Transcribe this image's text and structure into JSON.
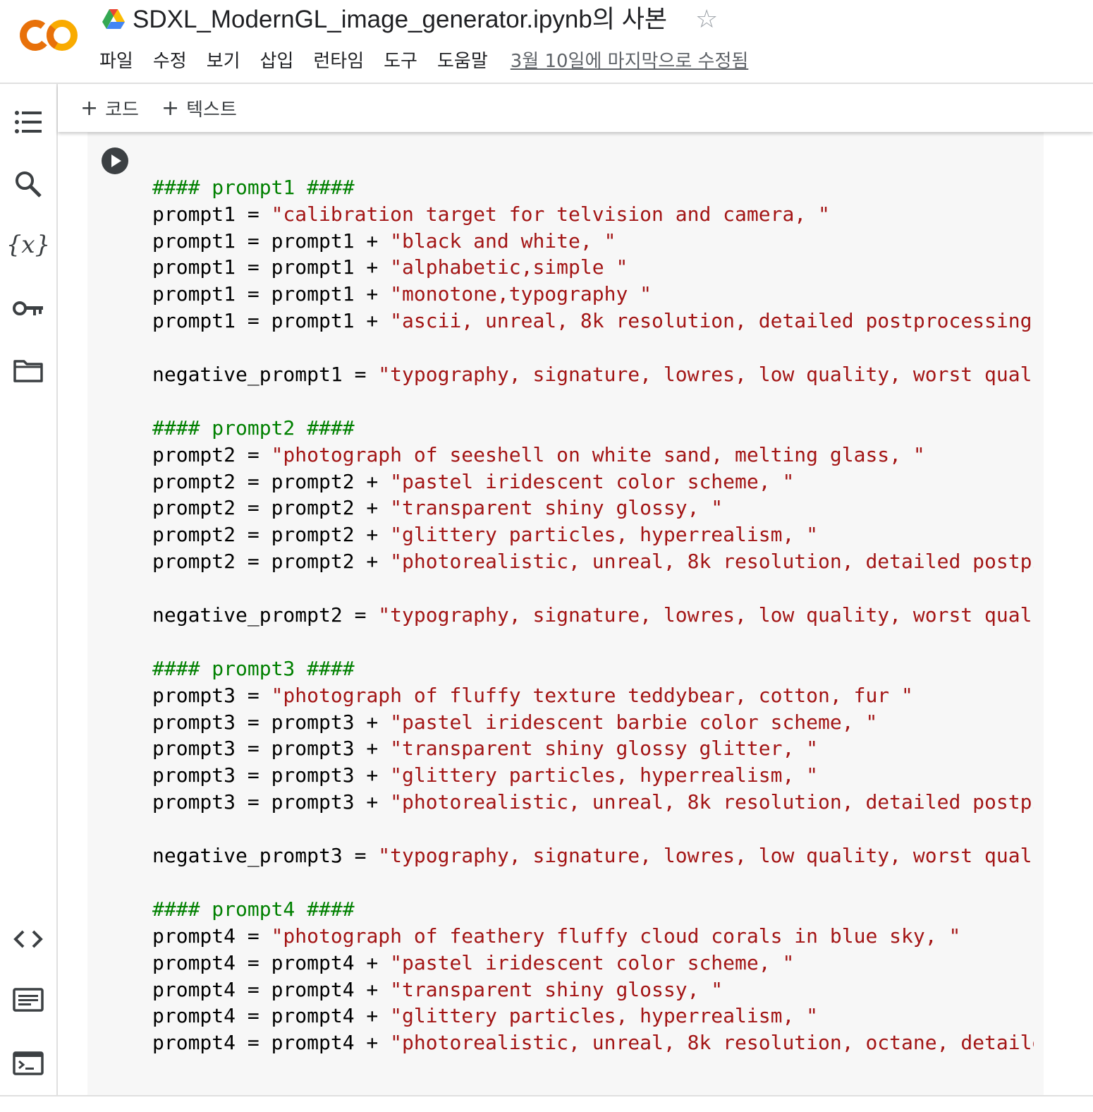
{
  "header": {
    "title": "SDXL_ModernGL_image_generator.ipynb의 사본",
    "logo_text": "CO",
    "menu": [
      "파일",
      "수정",
      "보기",
      "삽입",
      "런타임",
      "도구",
      "도움말"
    ],
    "last_edited": "3월 10일에 마지막으로 수정됨"
  },
  "toolbar": {
    "add_code_label": "코드",
    "add_text_label": "텍스트"
  },
  "left_rail": {
    "icons": [
      "toc-icon",
      "search-icon",
      "variables-icon",
      "key-icon",
      "folder-icon",
      "code-snippets-icon",
      "command-palette-icon",
      "terminal-icon"
    ]
  },
  "colors": {
    "string": "#a31515",
    "comment": "#008000",
    "logo_orange": "#f9ab00",
    "logo_dark": "#e8710a"
  },
  "code": {
    "lines": [
      {
        "t": "str",
        "text": "\"\"\""
      },
      {
        "t": "blank",
        "text": ""
      },
      {
        "t": "com",
        "text": "#### prompt1 ####"
      },
      {
        "t": "asg",
        "lhs": "prompt1 = ",
        "str": "\"calibration target for telvision and camera, \""
      },
      {
        "t": "asg",
        "lhs": "prompt1 = prompt1 + ",
        "str": "\"black and white, \""
      },
      {
        "t": "asg",
        "lhs": "prompt1 = prompt1 + ",
        "str": "\"alphabetic,simple \""
      },
      {
        "t": "asg",
        "lhs": "prompt1 = prompt1 + ",
        "str": "\"monotone,typography \""
      },
      {
        "t": "asg",
        "lhs": "prompt1 = prompt1 + ",
        "str": "\"ascii, unreal, 8k resolution, detailed postprocessing'"
      },
      {
        "t": "blank",
        "text": ""
      },
      {
        "t": "asg",
        "lhs": "negative_prompt1 = ",
        "str": "\"typography, signature, lowres, low quality, worst qual:"
      },
      {
        "t": "blank",
        "text": ""
      },
      {
        "t": "com",
        "text": "#### prompt2 ####"
      },
      {
        "t": "asg",
        "lhs": "prompt2 = ",
        "str": "\"photograph of seeshell on white sand, melting glass, \""
      },
      {
        "t": "asg",
        "lhs": "prompt2 = prompt2 + ",
        "str": "\"pastel iridescent color scheme, \""
      },
      {
        "t": "asg",
        "lhs": "prompt2 = prompt2 + ",
        "str": "\"transparent shiny glossy, \""
      },
      {
        "t": "asg",
        "lhs": "prompt2 = prompt2 + ",
        "str": "\"glittery particles, hyperrealism, \""
      },
      {
        "t": "asg",
        "lhs": "prompt2 = prompt2 + ",
        "str": "\"photorealistic, unreal, 8k resolution, detailed postpı"
      },
      {
        "t": "blank",
        "text": ""
      },
      {
        "t": "asg",
        "lhs": "negative_prompt2 = ",
        "str": "\"typography, signature, lowres, low quality, worst qual:"
      },
      {
        "t": "blank",
        "text": ""
      },
      {
        "t": "com",
        "text": "#### prompt3 ####"
      },
      {
        "t": "asg",
        "lhs": "prompt3 = ",
        "str": "\"photograph of fluffy texture teddybear, cotton, fur \""
      },
      {
        "t": "asg",
        "lhs": "prompt3 = prompt3 + ",
        "str": "\"pastel iridescent barbie color scheme, \""
      },
      {
        "t": "asg",
        "lhs": "prompt3 = prompt3 + ",
        "str": "\"transparent shiny glossy glitter, \""
      },
      {
        "t": "asg",
        "lhs": "prompt3 = prompt3 + ",
        "str": "\"glittery particles, hyperrealism, \""
      },
      {
        "t": "asg",
        "lhs": "prompt3 = prompt3 + ",
        "str": "\"photorealistic, unreal, 8k resolution, detailed postpı"
      },
      {
        "t": "blank",
        "text": ""
      },
      {
        "t": "asg",
        "lhs": "negative_prompt3 = ",
        "str": "\"typography, signature, lowres, low quality, worst qual:"
      },
      {
        "t": "blank",
        "text": ""
      },
      {
        "t": "com",
        "text": "#### prompt4 ####"
      },
      {
        "t": "asg",
        "lhs": "prompt4 = ",
        "str": "\"photograph of feathery fluffy cloud corals in blue sky, \""
      },
      {
        "t": "asg",
        "lhs": "prompt4 = prompt4 + ",
        "str": "\"pastel iridescent color scheme, \""
      },
      {
        "t": "asg",
        "lhs": "prompt4 = prompt4 + ",
        "str": "\"transparent shiny glossy, \""
      },
      {
        "t": "asg",
        "lhs": "prompt4 = prompt4 + ",
        "str": "\"glittery particles, hyperrealism, \""
      },
      {
        "t": "asg",
        "lhs": "prompt4 = prompt4 + ",
        "str": "\"photorealistic, unreal, 8k resolution, octane, detaile"
      }
    ]
  }
}
